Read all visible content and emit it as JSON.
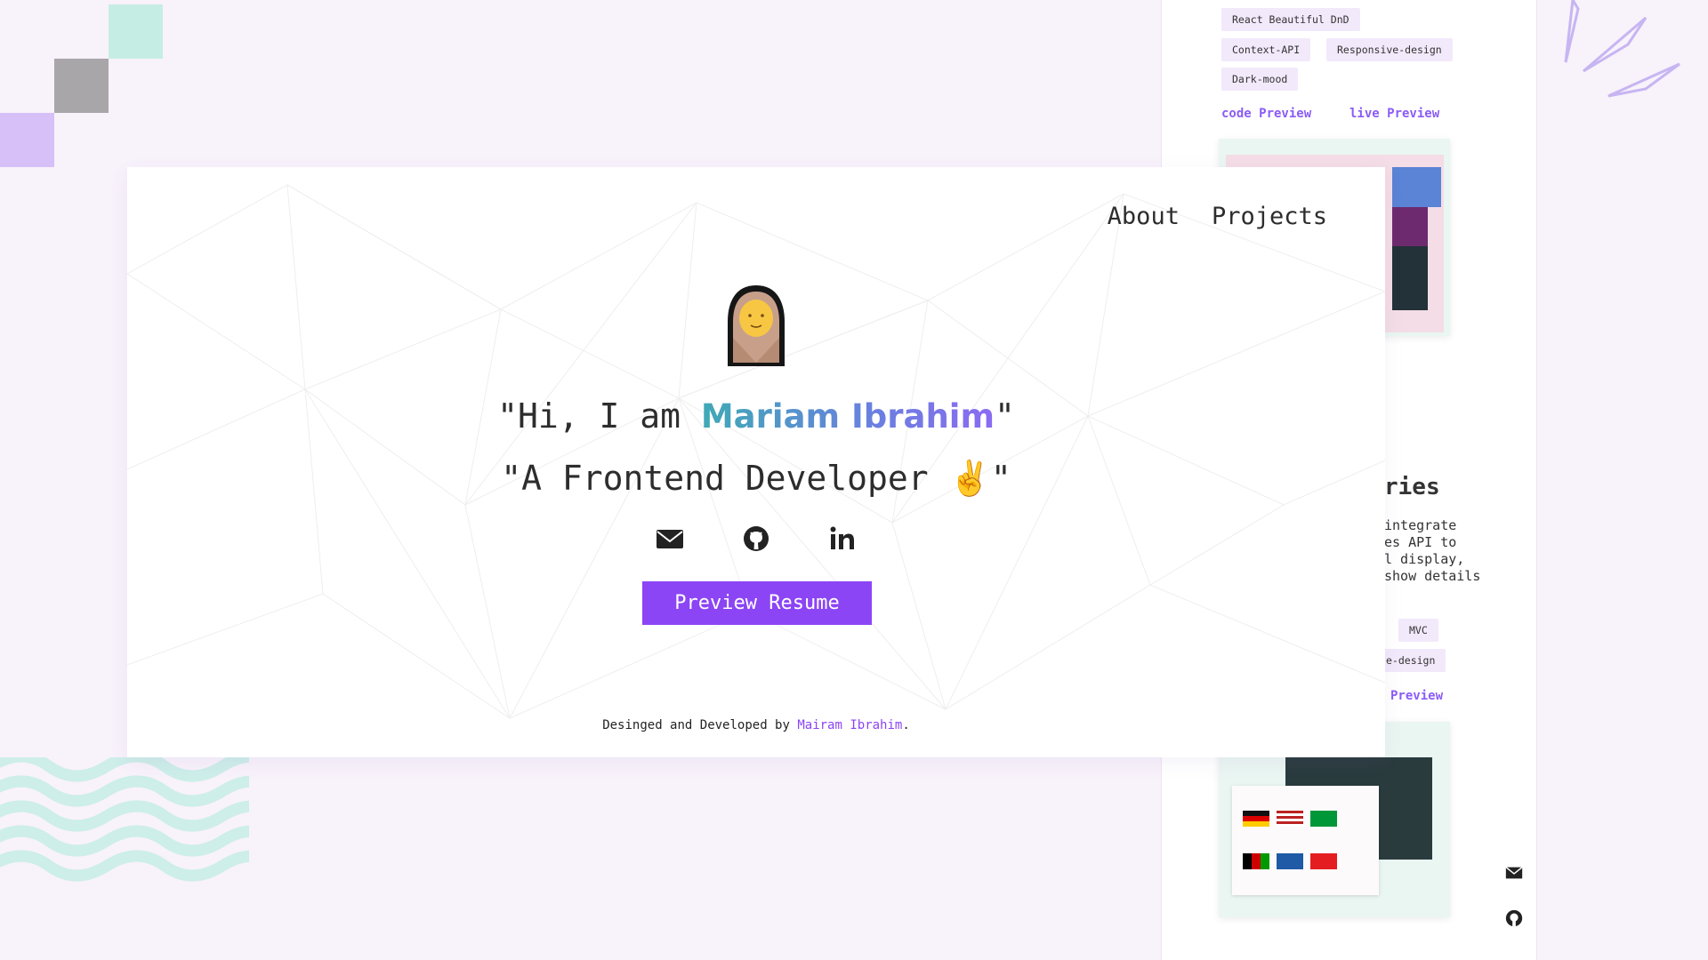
{
  "background_page": {
    "tags_top": [
      "React Beautiful DnD",
      "Context-API",
      "Responsive-design",
      "Dark-mood"
    ],
    "links_top": [
      "code Preview",
      "live Preview"
    ],
    "project_title_fragment": "ries",
    "description_fragments": [
      "integrate",
      "es API to",
      "l display,",
      "show details"
    ],
    "tags_bottom": [
      "MVC",
      "e-design"
    ],
    "link_bottom": "Preview"
  },
  "nav": {
    "about": "About",
    "projects": "Projects"
  },
  "hero": {
    "line1_prefix": "\"Hi, I am ",
    "name": "Mariam Ibrahim",
    "line1_suffix": "\"",
    "line2_prefix": "\"A Frontend Developer ",
    "line2_emoji": "✌️",
    "line2_suffix": "\""
  },
  "social_icons": [
    "envelope-icon",
    "github-icon",
    "linkedin-icon"
  ],
  "resume_button": "Preview Resume",
  "footer": {
    "prefix": "Desinged and Developed by ",
    "author": "Mairam Ibrahim",
    "suffix": "."
  },
  "colors": {
    "accent": "#8b45f5",
    "page_bg": "#f8f2fb"
  }
}
